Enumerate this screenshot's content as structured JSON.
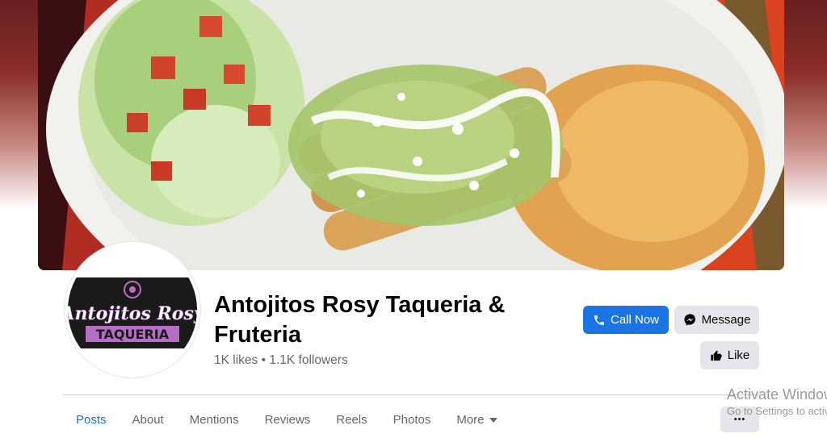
{
  "page": {
    "name": "Antojitos Rosy Taqueria & Fruteria",
    "likes": "1K likes",
    "separator": "•",
    "followers": "1.1K followers"
  },
  "logo": {
    "line1": "Antojitos Rosy",
    "line2": "TAQUERIA"
  },
  "actions": {
    "call_label": "Call Now",
    "message_label": "Message",
    "like_label": "Like",
    "more_label": "•••"
  },
  "tabs": [
    {
      "label": "Posts",
      "active": true
    },
    {
      "label": "About",
      "active": false
    },
    {
      "label": "Mentions",
      "active": false
    },
    {
      "label": "Reviews",
      "active": false
    },
    {
      "label": "Reels",
      "active": false
    },
    {
      "label": "Photos",
      "active": false
    },
    {
      "label": "More",
      "active": false
    }
  ],
  "watermark": {
    "title": "Activate Windows",
    "subtitle": "Go to Settings to activate Windows."
  },
  "colors": {
    "primary": "#1b74e4",
    "secondary_button": "#e4e6eb",
    "muted_text": "#65676b"
  },
  "icons": {
    "call": "phone-icon",
    "message": "messenger-icon",
    "like": "thumbs-up-icon",
    "more_tab": "caret-down-icon"
  }
}
